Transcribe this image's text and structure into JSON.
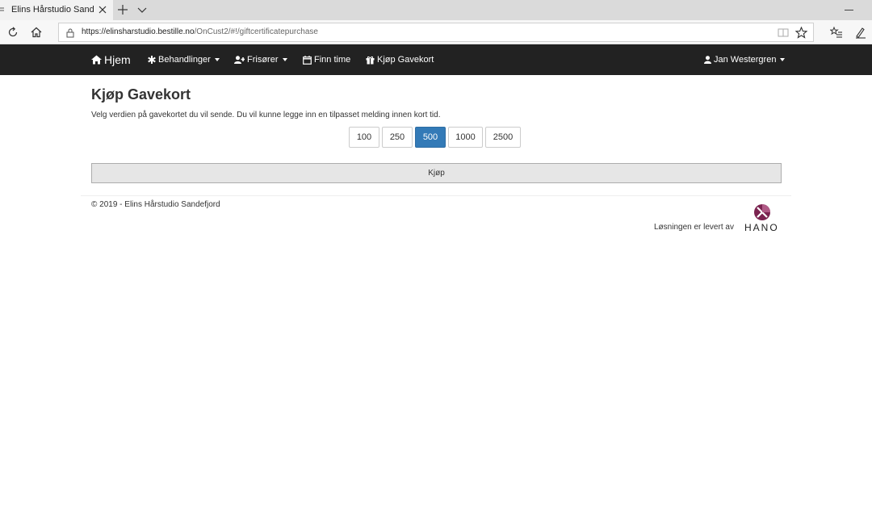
{
  "browser": {
    "tab_title": "Elins Hårstudio Sandefjo",
    "url_host": "https://elinsharstudio.bestille.no",
    "url_path": "/OnCust2/#!/giftcertificatepurchase"
  },
  "nav": {
    "brand": "Hjem",
    "items": [
      {
        "label": "Behandlinger",
        "icon": "asterisk-icon"
      },
      {
        "label": "Frisører",
        "icon": "user-plus-icon"
      },
      {
        "label": "Finn time",
        "icon": "calendar-icon"
      },
      {
        "label": "Kjøp Gavekort",
        "icon": "gift-icon"
      }
    ],
    "user": "Jan Westergren"
  },
  "main": {
    "title": "Kjøp Gavekort",
    "intro": "Velg verdien på gavekortet du vil sende. Du vil kunne legge inn en tilpasset melding innen kort tid.",
    "amounts": [
      "100",
      "250",
      "500",
      "1000",
      "2500"
    ],
    "selected_amount": "500",
    "buy_label": "Kjøp"
  },
  "footer": {
    "copyright": "© 2019 - Elins Hårstudio Sandefjord",
    "provided_by": "Løsningen er levert av",
    "vendor": "HANO"
  },
  "colors": {
    "navbar": "#222222",
    "active_button": "#337ab7",
    "logo_accent": "#7b2350"
  }
}
